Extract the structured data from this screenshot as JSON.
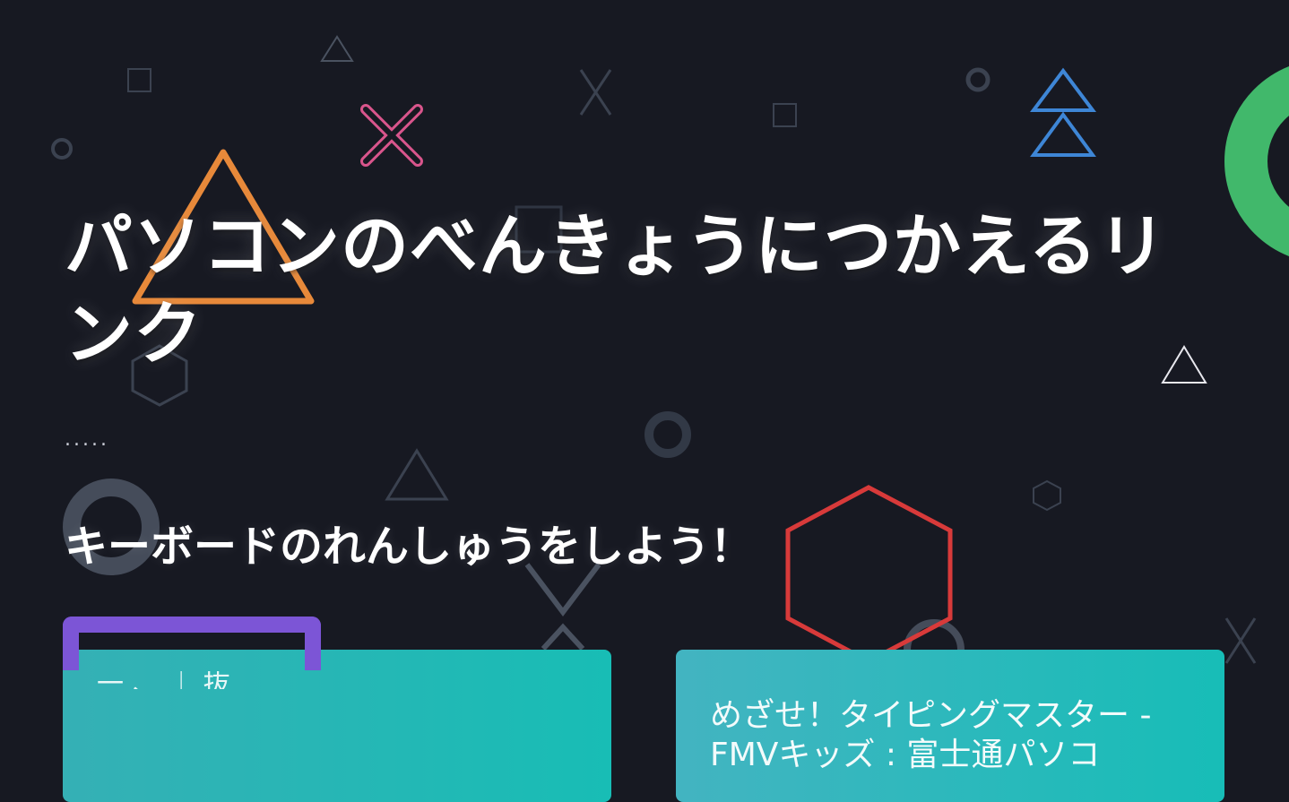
{
  "page": {
    "title": "パソコンのべんきょうにつかえるリンク",
    "divider": ".....",
    "section_heading": "キーボードのれんしゅうをしよう！"
  },
  "cards": [
    {
      "title": "一 、 ｜ 抜"
    },
    {
      "title": "めざせ！タイピングマスター - FMVキッズ : 富士通パソコ"
    }
  ],
  "colors": {
    "background": "#171922",
    "accent_orange": "#e7893a",
    "accent_pink": "#d9558c",
    "accent_blue": "#3e86d6",
    "accent_green": "#41b86b",
    "accent_red": "#d83a3a",
    "accent_purple": "#7c55d6",
    "muted_shape": "#3b4250",
    "card_teal": "#1dbab5"
  },
  "decorations": {
    "icons": [
      "square-icon",
      "triangle-icon",
      "x-cross-icon",
      "ring-icon",
      "hexagon-icon",
      "double-triangle-icon"
    ]
  }
}
